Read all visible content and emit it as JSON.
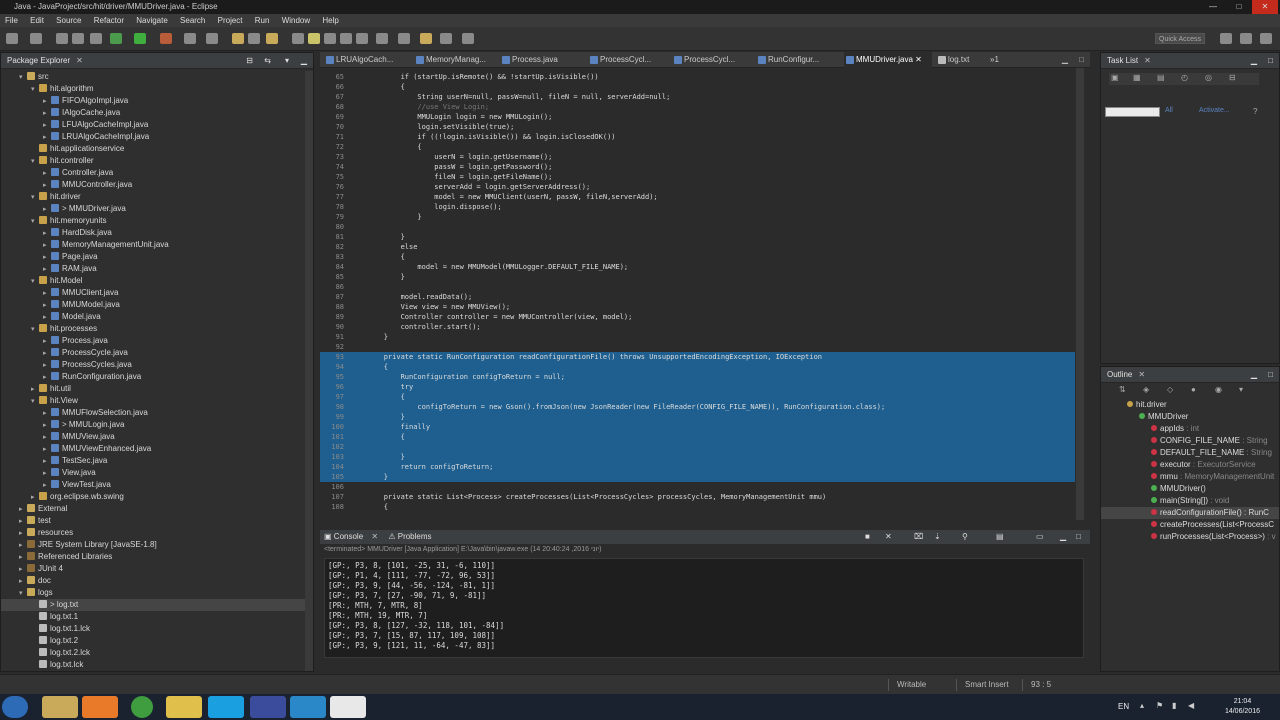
{
  "window": {
    "title": "Java - JavaProject/src/hit/driver/MMUDriver.java - Eclipse"
  },
  "menu": [
    "File",
    "Edit",
    "Source",
    "Refactor",
    "Navigate",
    "Search",
    "Project",
    "Run",
    "Window",
    "Help"
  ],
  "quick_access": {
    "placeholder": "Quick Access"
  },
  "package_explorer": {
    "title": "Package Explorer",
    "rows": [
      {
        "label": "src",
        "icon": "folder-icon",
        "depth": 2,
        "twist": "▾"
      },
      {
        "label": "hit.algorithm",
        "icon": "package-icon",
        "depth": 3,
        "twist": "▾"
      },
      {
        "label": "FIFOAlgoImpl.java",
        "icon": "java-file-icon",
        "depth": 4,
        "twist": "▸"
      },
      {
        "label": "IAlgoCache.java",
        "icon": "java-file-icon",
        "depth": 4,
        "twist": "▸"
      },
      {
        "label": "LFUAlgoCacheImpl.java",
        "icon": "java-file-icon",
        "depth": 4,
        "twist": "▸"
      },
      {
        "label": "LRUAlgoCacheImpl.java",
        "icon": "java-file-icon",
        "depth": 4,
        "twist": "▸"
      },
      {
        "label": "hit.applicationservice",
        "icon": "package-icon",
        "depth": 3,
        "twist": ""
      },
      {
        "label": "hit.controller",
        "icon": "package-icon",
        "depth": 3,
        "twist": "▾"
      },
      {
        "label": "Controller.java",
        "icon": "java-file-icon",
        "depth": 4,
        "twist": "▸"
      },
      {
        "label": "MMUController.java",
        "icon": "java-file-icon",
        "depth": 4,
        "twist": "▸"
      },
      {
        "label": "hit.driver",
        "icon": "package-icon",
        "depth": 3,
        "twist": "▾"
      },
      {
        "label": "> MMUDriver.java",
        "icon": "java-file-icon",
        "depth": 4,
        "twist": "▸"
      },
      {
        "label": "hit.memoryunits",
        "icon": "package-icon",
        "depth": 3,
        "twist": "▾"
      },
      {
        "label": "HardDisk.java",
        "icon": "java-file-icon",
        "depth": 4,
        "twist": "▸"
      },
      {
        "label": "MemoryManagementUnit.java",
        "icon": "java-file-icon",
        "depth": 4,
        "twist": "▸"
      },
      {
        "label": "Page.java",
        "icon": "java-file-icon",
        "depth": 4,
        "twist": "▸"
      },
      {
        "label": "RAM.java",
        "icon": "java-file-icon",
        "depth": 4,
        "twist": "▸"
      },
      {
        "label": "hit.Model",
        "icon": "package-icon",
        "depth": 3,
        "twist": "▾"
      },
      {
        "label": "MMUClient.java",
        "icon": "java-file-icon",
        "depth": 4,
        "twist": "▸"
      },
      {
        "label": "MMUModel.java",
        "icon": "java-file-icon",
        "depth": 4,
        "twist": "▸"
      },
      {
        "label": "Model.java",
        "icon": "java-file-icon",
        "depth": 4,
        "twist": "▸"
      },
      {
        "label": "hit.processes",
        "icon": "package-icon",
        "depth": 3,
        "twist": "▾"
      },
      {
        "label": "Process.java",
        "icon": "java-file-icon",
        "depth": 4,
        "twist": "▸"
      },
      {
        "label": "ProcessCycle.java",
        "icon": "java-file-icon",
        "depth": 4,
        "twist": "▸"
      },
      {
        "label": "ProcessCycles.java",
        "icon": "java-file-icon",
        "depth": 4,
        "twist": "▸"
      },
      {
        "label": "RunConfiguration.java",
        "icon": "java-file-icon",
        "depth": 4,
        "twist": "▸"
      },
      {
        "label": "hit.util",
        "icon": "package-icon",
        "depth": 3,
        "twist": "▸"
      },
      {
        "label": "hit.View",
        "icon": "package-icon",
        "depth": 3,
        "twist": "▾"
      },
      {
        "label": "MMUFlowSelection.java",
        "icon": "java-file-icon",
        "depth": 4,
        "twist": "▸"
      },
      {
        "label": "> MMULogin.java",
        "icon": "java-file-icon",
        "depth": 4,
        "twist": "▸"
      },
      {
        "label": "MMUView.java",
        "icon": "java-file-icon",
        "depth": 4,
        "twist": "▸"
      },
      {
        "label": "MMUViewEnhanced.java",
        "icon": "java-file-icon",
        "depth": 4,
        "twist": "▸"
      },
      {
        "label": "TestSec.java",
        "icon": "java-file-icon",
        "depth": 4,
        "twist": "▸"
      },
      {
        "label": "View.java",
        "icon": "java-file-icon",
        "depth": 4,
        "twist": "▸"
      },
      {
        "label": "ViewTest.java",
        "icon": "java-file-icon",
        "depth": 4,
        "twist": "▸"
      },
      {
        "label": "org.eclipse.wb.swing",
        "icon": "package-icon",
        "depth": 3,
        "twist": "▸"
      },
      {
        "label": "External",
        "icon": "folder-icon",
        "depth": 2,
        "twist": "▸"
      },
      {
        "label": "test",
        "icon": "folder-icon",
        "depth": 2,
        "twist": "▸"
      },
      {
        "label": "resources",
        "icon": "folder-icon",
        "depth": 2,
        "twist": "▸"
      },
      {
        "label": "JRE System Library [JavaSE-1.8]",
        "icon": "library-icon",
        "depth": 2,
        "twist": "▸"
      },
      {
        "label": "Referenced Libraries",
        "icon": "library-icon",
        "depth": 2,
        "twist": "▸"
      },
      {
        "label": "JUnit 4",
        "icon": "library-icon",
        "depth": 2,
        "twist": "▸"
      },
      {
        "label": "doc",
        "icon": "folder-icon",
        "depth": 2,
        "twist": "▸"
      },
      {
        "label": "logs",
        "icon": "folder-icon",
        "depth": 2,
        "twist": "▾"
      },
      {
        "label": "> log.txt",
        "icon": "text-file-icon",
        "depth": 3,
        "twist": "",
        "selected": true
      },
      {
        "label": "log.txt.1",
        "icon": "text-file-icon",
        "depth": 3,
        "twist": ""
      },
      {
        "label": "log.txt.1.lck",
        "icon": "text-file-icon",
        "depth": 3,
        "twist": ""
      },
      {
        "label": "log.txt.2",
        "icon": "text-file-icon",
        "depth": 3,
        "twist": ""
      },
      {
        "label": "log.txt.2.lck",
        "icon": "text-file-icon",
        "depth": 3,
        "twist": ""
      },
      {
        "label": "log.txt.lck",
        "icon": "text-file-icon",
        "depth": 3,
        "twist": ""
      }
    ]
  },
  "editor_tabs": [
    "LRUAlgoCach...",
    "MemoryManag...",
    "Process.java",
    "ProcessCycl...",
    "ProcessCycl...",
    "RunConfigur...",
    "MMUDriver.java",
    "log.txt"
  ],
  "editor_tabs_overflow": "»1",
  "code_lines": [
    {
      "n": "65",
      "t": "            if (startUp.isRemote() && !startUp.isVisible())"
    },
    {
      "n": "66",
      "t": "            {"
    },
    {
      "n": "67",
      "t": "                String userN=null, passW=null, fileN = null, serverAdd=null;"
    },
    {
      "n": "68",
      "t": "                //use View Login;"
    },
    {
      "n": "69",
      "t": "                MMULogin login = new MMULogin();"
    },
    {
      "n": "70",
      "t": "                login.setVisible(true);"
    },
    {
      "n": "71",
      "t": "                if ((!login.isVisible()) && login.isClosedOK())"
    },
    {
      "n": "72",
      "t": "                {"
    },
    {
      "n": "73",
      "t": "                    userN = login.getUsername();"
    },
    {
      "n": "74",
      "t": "                    passW = login.getPassword();"
    },
    {
      "n": "75",
      "t": "                    fileN = login.getFileName();"
    },
    {
      "n": "76",
      "t": "                    serverAdd = login.getServerAddress();"
    },
    {
      "n": "77",
      "t": "                    model = new MMUClient(userN, passW, fileN,serverAdd);"
    },
    {
      "n": "78",
      "t": "                    login.dispose();"
    },
    {
      "n": "79",
      "t": "                }"
    },
    {
      "n": "80",
      "t": ""
    },
    {
      "n": "81",
      "t": "            }"
    },
    {
      "n": "82",
      "t": "            else"
    },
    {
      "n": "83",
      "t": "            {"
    },
    {
      "n": "84",
      "t": "                model = new MMUModel(MMULogger.DEFAULT_FILE_NAME);"
    },
    {
      "n": "85",
      "t": "            }"
    },
    {
      "n": "86",
      "t": ""
    },
    {
      "n": "87",
      "t": "            model.readData();"
    },
    {
      "n": "88",
      "t": "            View view = new MMUView();"
    },
    {
      "n": "89",
      "t": "            Controller controller = new MMUController(view, model);"
    },
    {
      "n": "90",
      "t": "            controller.start();"
    },
    {
      "n": "91",
      "t": "        }"
    },
    {
      "n": "92",
      "t": ""
    },
    {
      "n": "93",
      "t": "        private static RunConfiguration readConfigurationFile() throws UnsupportedEncodingException, IOException",
      "sel": true
    },
    {
      "n": "94",
      "t": "        {",
      "sel": true
    },
    {
      "n": "95",
      "t": "            RunConfiguration configToReturn = null;",
      "sel": true
    },
    {
      "n": "96",
      "t": "            try",
      "sel": true
    },
    {
      "n": "97",
      "t": "            {",
      "sel": true
    },
    {
      "n": "98",
      "t": "                configToReturn = new Gson().fromJson(new JsonReader(new FileReader(CONFIG_FILE_NAME)), RunConfiguration.class);",
      "sel": true
    },
    {
      "n": "99",
      "t": "            }",
      "sel": true
    },
    {
      "n": "100",
      "t": "            finally",
      "sel": true
    },
    {
      "n": "101",
      "t": "            {",
      "sel": true
    },
    {
      "n": "102",
      "t": "",
      "sel": true
    },
    {
      "n": "103",
      "t": "            }",
      "sel": true
    },
    {
      "n": "104",
      "t": "            return configToReturn;",
      "sel": true
    },
    {
      "n": "105",
      "t": "        }",
      "sel": true
    },
    {
      "n": "106",
      "t": ""
    },
    {
      "n": "107",
      "t": "        private static List<Process> createProcesses(List<ProcessCycles> processCycles, MemoryManagementUnit mmu)"
    },
    {
      "n": "108",
      "t": "        {"
    }
  ],
  "console": {
    "tab_console": "Console",
    "tab_problems": "Problems",
    "status": "<terminated> MMUDriver [Java Application] E:\\Java\\bin\\javaw.exe (14 20:40:24 ,2016 יוני)",
    "lines": [
      "[GP:, P3, 8, [101, -25, 31, -6, 110]]",
      "[GP:, P1, 4, [111, -77, -72, 96, 53]]",
      "[GP:, P3, 9, [44, -56, -124, -81, 1]]",
      "[GP:, P3, 7, [27, -90, 71, 9, -81]]",
      "[PR:, MTH, 7, MTR, 8]",
      "[PR:, MTH, 19, MTR, 7]",
      "[GP:, P3, 8, [127, -32, 118, 101, -84]]",
      "[GP:, P3, 7, [15, 87, 117, 109, 108]]",
      "[GP:, P3, 9, [121, 11, -64, -47, 83]]"
    ]
  },
  "task_list": {
    "title": "Task List",
    "find_all": "All",
    "activate": "Activate..."
  },
  "outline": {
    "title": "Outline",
    "rows": [
      {
        "label": "hit.driver",
        "type": "",
        "depth": 0,
        "color": "#c8a24a"
      },
      {
        "label": "MMUDriver",
        "type": "",
        "depth": 1,
        "color": "#4caf50"
      },
      {
        "label": "appIds",
        "type": " : int",
        "depth": 2,
        "color": "#cc3344"
      },
      {
        "label": "CONFIG_FILE_NAME",
        "type": " : String",
        "depth": 2,
        "color": "#cc3344"
      },
      {
        "label": "DEFAULT_FILE_NAME",
        "type": " : String",
        "depth": 2,
        "color": "#cc3344"
      },
      {
        "label": "executor",
        "type": " : ExecutorService",
        "depth": 2,
        "color": "#cc3344"
      },
      {
        "label": "mmu",
        "type": " : MemoryManagementUnit",
        "depth": 2,
        "color": "#cc3344"
      },
      {
        "label": "MMUDriver()",
        "type": "",
        "depth": 2,
        "color": "#4caf50"
      },
      {
        "label": "main(String[])",
        "type": " : void",
        "depth": 2,
        "color": "#4caf50"
      },
      {
        "label": "readConfigurationFile() : RunC",
        "type": "",
        "depth": 2,
        "color": "#cc3344",
        "selected": true
      },
      {
        "label": "createProcesses(List<ProcessC",
        "type": "",
        "depth": 2,
        "color": "#cc3344"
      },
      {
        "label": "runProcesses(List<Process>)",
        "type": " : v",
        "depth": 2,
        "color": "#cc3344"
      }
    ]
  },
  "status_bar": {
    "writable": "Writable",
    "insert_mode": "Smart Insert",
    "position": "93 : 5"
  },
  "taskbar": {
    "lang": "EN",
    "time": "21:04",
    "date": "14/06/2016"
  },
  "colors": {
    "selection": "#1e5f8f",
    "keyword": "#cc5577"
  }
}
